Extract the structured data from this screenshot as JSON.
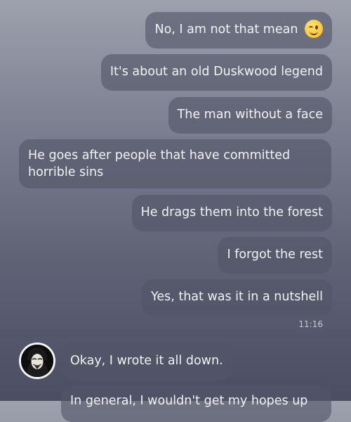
{
  "conversation": {
    "outgoing": [
      {
        "text": "No, I am not that mean",
        "emoji": "winking-face"
      },
      {
        "text": "It's about an old Duskwood legend"
      },
      {
        "text": "The man without a face"
      },
      {
        "text": "He goes after people that have committed horrible sins"
      },
      {
        "text": "He drags them into the forest"
      },
      {
        "text": "I forgot the rest"
      },
      {
        "text": "Yes, that was it in a nutshell"
      }
    ],
    "outgoing_time": "11:16",
    "incoming": [
      {
        "text": "Okay, I wrote it all down."
      },
      {
        "text": "In general, I wouldn't get my hopes up"
      }
    ],
    "contact_avatar": "masked-face-avatar"
  }
}
